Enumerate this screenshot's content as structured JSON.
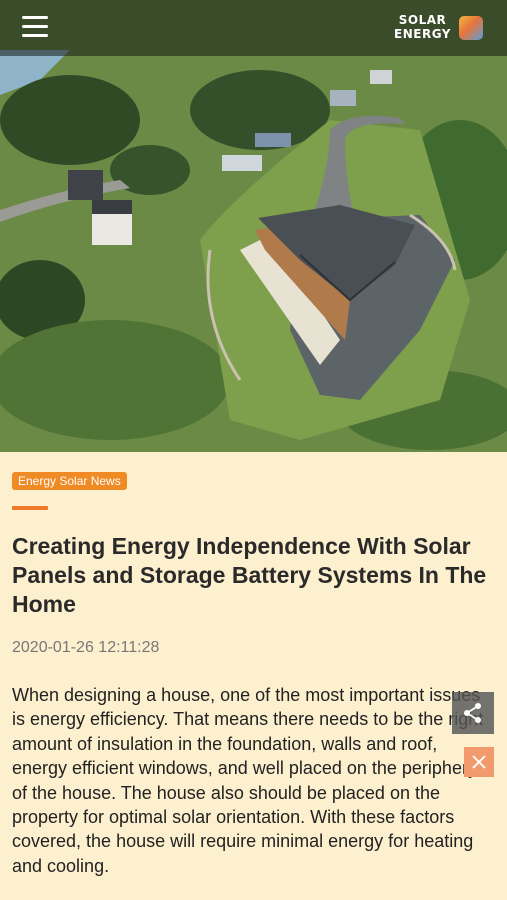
{
  "header": {
    "brand_line1": "SOLAR",
    "brand_line2": "ENERGY",
    "menu_icon": "hamburger-menu-icon",
    "logo_icon": "app-logo-icon"
  },
  "hero": {
    "image": "aerial-house-photo"
  },
  "article": {
    "category": "Energy Solar News",
    "title": "Creating Energy Independence With Solar Panels and Storage Battery Systems In The Home",
    "date": "2020-01-26 12:11:28",
    "body": "When designing a house, one of the most important issues is energy efficiency. That means there needs to be the right amount of insulation in the foundation, walls and roof, energy efficient windows, and well placed on the periphery of the house. The house also should be placed on the property for optimal solar orientation. With these factors covered, the house will require minimal energy for heating and cooling."
  },
  "floating": {
    "share_icon": "share-icon",
    "close_icon": "close-icon"
  },
  "colors": {
    "background": "#fdf0cf",
    "accent": "#f08a24",
    "title": "#2a2a2a"
  }
}
